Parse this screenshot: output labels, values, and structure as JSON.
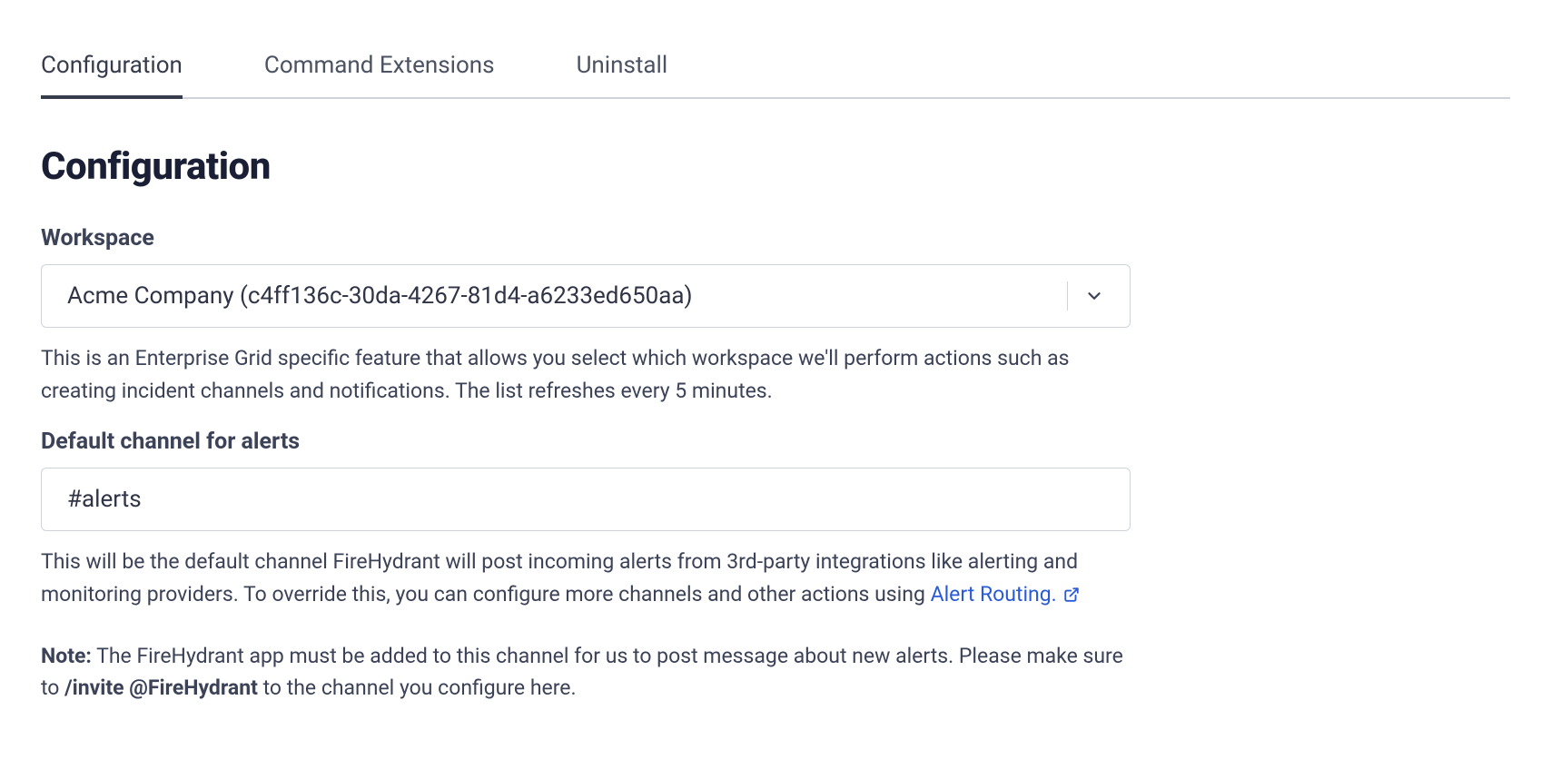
{
  "tabs": {
    "configuration": "Configuration",
    "command_extensions": "Command Extensions",
    "uninstall": "Uninstall"
  },
  "heading": "Configuration",
  "workspace": {
    "label": "Workspace",
    "value": "Acme Company (c4ff136c-30da-4267-81d4-a6233ed650aa)",
    "help": "This is an Enterprise Grid specific feature that allows you select which workspace we'll perform actions such as creating incident channels and notifications. The list refreshes every 5 minutes."
  },
  "alerts_channel": {
    "label": "Default channel for alerts",
    "value": "#alerts",
    "help_part1": "This will be the default channel FireHydrant will post incoming alerts from 3rd-party integrations like alerting and monitoring providers. To override this, you can configure more channels and other actions using ",
    "help_link_text": "Alert Routing.",
    "note_label": "Note:",
    "note_part1": " The FireHydrant app must be added to this channel for us to post message about new alerts. Please make sure to ",
    "note_command": "/invite @FireHydrant",
    "note_part2": " to the channel you configure here."
  }
}
